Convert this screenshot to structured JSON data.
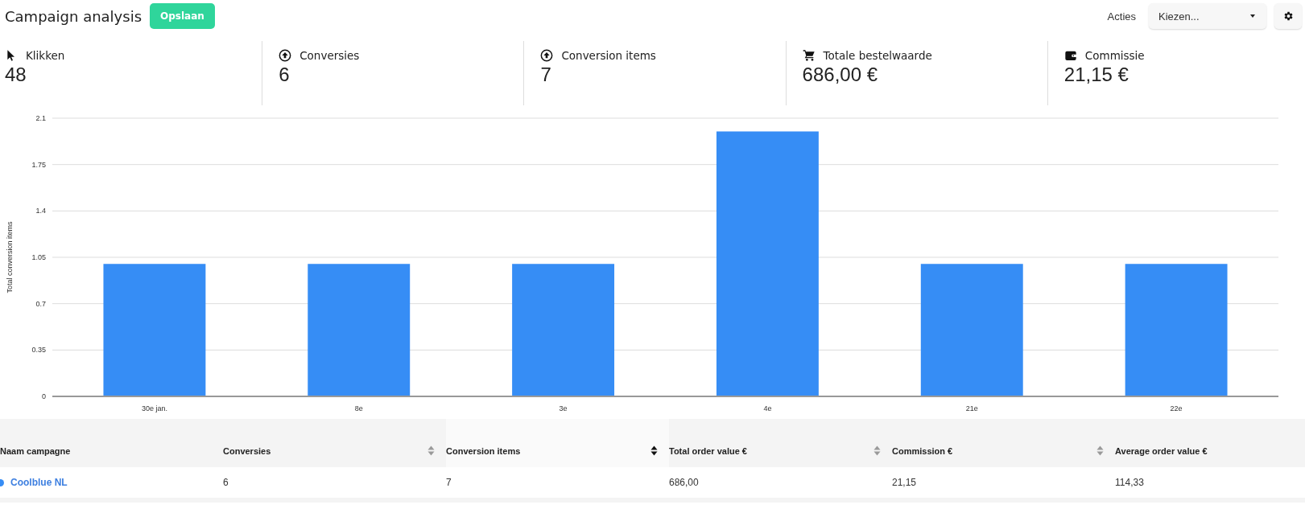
{
  "header": {
    "title": "Campaign analysis",
    "save_button": "Opslaan",
    "actions_label": "Acties",
    "actions_select": {
      "value": "Kiezen..."
    }
  },
  "stats": [
    {
      "kind": "clicks",
      "label": "Klikken",
      "value": "48"
    },
    {
      "kind": "conversions",
      "label": "Conversies",
      "value": "6"
    },
    {
      "kind": "items",
      "label": "Conversion items",
      "value": "7"
    },
    {
      "kind": "order-value",
      "label": "Totale bestelwaarde",
      "value": "686,00 €"
    },
    {
      "kind": "commission",
      "label": "Commissie",
      "value": "21,15 €"
    }
  ],
  "chart": {
    "chart_data": {
      "type": "bar",
      "ylabel": "Total conversion items",
      "categories": [
        "30e jan.",
        "8e",
        "3e",
        "4e",
        "21e",
        "22e"
      ],
      "values": [
        1,
        1,
        1,
        2,
        1,
        1
      ],
      "color": "#368df5",
      "grid": true,
      "ylim": [
        0,
        2.1
      ],
      "yticks": [
        0,
        0.35,
        0.7,
        1.05,
        1.4,
        1.75,
        2.1
      ]
    }
  },
  "table": {
    "columns": [
      {
        "label": "Naam campagne",
        "sortable": false
      },
      {
        "label": "Conversies",
        "sortable": true,
        "selected": false
      },
      {
        "label": "Conversion items",
        "sortable": true,
        "selected": true
      },
      {
        "label": "Total order value €",
        "sortable": true,
        "selected": false
      },
      {
        "label": "Commission €",
        "sortable": true,
        "selected": false
      },
      {
        "label": "Average order value €",
        "sortable": false
      }
    ],
    "rows": [
      {
        "color": "#368df5",
        "cells": [
          "Coolblue NL",
          "6",
          "7",
          "686,00",
          "21,15",
          "114,33"
        ]
      }
    ]
  }
}
